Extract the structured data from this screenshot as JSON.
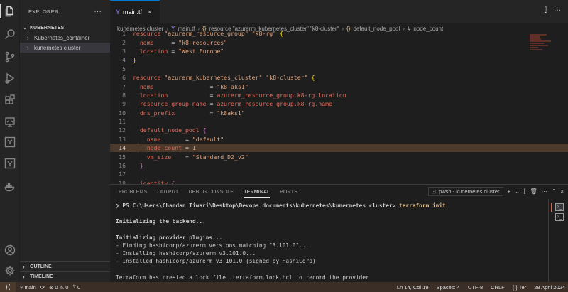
{
  "colors": {
    "accent": "#0078d4",
    "current_line": "#4b3a2b",
    "keyword": "#e06c5c",
    "string": "#e0a37d"
  },
  "activity_icons": [
    "files-icon",
    "search-icon",
    "source-control-icon",
    "run-debug-icon",
    "extensions-icon",
    "remote-explorer-icon",
    "terraform-icon",
    "azure-icon",
    "docker-icon",
    "account-icon",
    "settings-gear-icon"
  ],
  "sidebar": {
    "title": "EXPLORER",
    "more": "···",
    "section": "KUBERNETES",
    "items": [
      {
        "label": "Kubernetes_container"
      },
      {
        "label": "kunernetes cluster"
      }
    ],
    "outline": "OUTLINE",
    "timeline": "TIMELINE"
  },
  "tab": {
    "label": "main.tf",
    "close": "×",
    "icon": "Y"
  },
  "tab_actions": {
    "split": "⫿",
    "more": "···"
  },
  "breadcrumb": {
    "folder": "kunernetes cluster",
    "file": "main.tf",
    "resource": "resource \"azurerm_kubernetes_cluster\" \"k8-cluster\"",
    "block": "default_node_pool",
    "attr": "node_count"
  },
  "code": {
    "line_numbers": [
      "1",
      "2",
      "3",
      "4",
      "5",
      "6",
      "7",
      "8",
      "9",
      "10",
      "11",
      "12",
      "13",
      "14",
      "15",
      "16",
      "17",
      "18"
    ]
  },
  "panel": {
    "tabs": [
      "PROBLEMS",
      "OUTPUT",
      "DEBUG CONSOLE",
      "TERMINAL",
      "PORTS"
    ],
    "active_tab": "TERMINAL",
    "terminal_name": "pwsh - kunernetes cluster",
    "prompt": "PS C:\\Users\\Chandan Tiwari\\Desktop\\Devops documents\\kubernetes\\kunernetes cluster>",
    "command": "terraform init",
    "output": [
      "",
      "Initializing the backend...",
      "",
      "Initializing provider plugins...",
      "- Finding hashicorp/azurerm versions matching \"3.101.0\"...",
      "- Installing hashicorp/azurerm v3.101.0...",
      "- Installed hashicorp/azurerm v3.101.0 (signed by HashiCorp)",
      "",
      "Terraform has created a lock file .terraform.lock.hcl to record the provider"
    ]
  },
  "status": {
    "branch": "main",
    "errors": "0",
    "warnings": "0",
    "ports": "0",
    "position": "Ln 14, Col 19",
    "spaces": "Spaces: 4",
    "encoding": "UTF-8",
    "eol": "CRLF",
    "language": "Ter",
    "date": "28 April 2024"
  }
}
